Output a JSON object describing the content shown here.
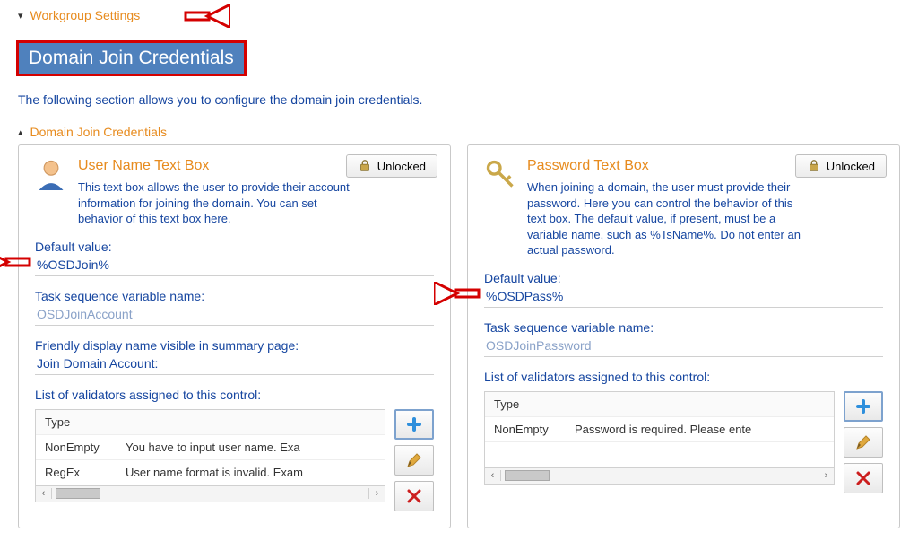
{
  "top_expander": {
    "label": "Workgroup Settings"
  },
  "banner": "Domain Join Credentials",
  "intro": "The following section allows you to configure the domain join credentials.",
  "sub_expander": {
    "label": "Domain Join Credentials"
  },
  "left": {
    "title": "User Name Text Box",
    "desc": "This text box allows the user to provide their account information for joining the domain. You can set behavior of this text box here.",
    "default_label": "Default value:",
    "default_value": "%OSDJoin%",
    "tsv_label": "Task sequence variable name:",
    "tsv_value": "OSDJoinAccount",
    "friendly_label": "Friendly display name visible in summary page:",
    "friendly_value": "Join Domain Account:",
    "validators_label": "List of validators assigned to this control:",
    "th_type": "Type",
    "rows": [
      {
        "type": "NonEmpty",
        "msg": "You have to input user name. Exa"
      },
      {
        "type": "RegEx",
        "msg": "User name format is invalid. Exam"
      }
    ]
  },
  "right": {
    "title": "Password Text Box",
    "desc": "When joining a domain, the user must provide their password. Here you can control the behavior of this text box. The default value, if present, must be a variable name, such as %TsName%. Do not enter an actual password.",
    "default_label": "Default value:",
    "default_value": "%OSDPass%",
    "tsv_label": "Task sequence variable name:",
    "tsv_value": "OSDJoinPassword",
    "validators_label": "List of validators assigned to this control:",
    "th_type": "Type",
    "rows": [
      {
        "type": "NonEmpty",
        "msg": "Password is required. Please ente"
      }
    ]
  },
  "unlocked_label": "Unlocked"
}
